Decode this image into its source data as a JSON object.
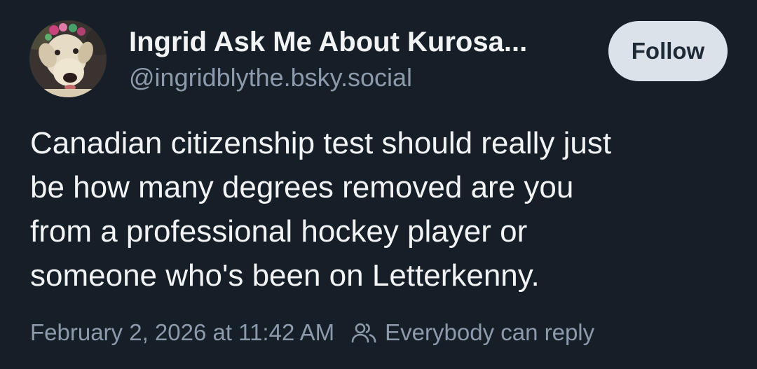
{
  "author": {
    "display_name": "Ingrid Ask Me About Kurosa...",
    "handle": "@ingridblythe.bsky.social",
    "avatar_icon": "dog-avatar-image"
  },
  "actions": {
    "follow_label": "Follow"
  },
  "post": {
    "text": "Canadian citizenship test should really just\nbe how many degrees removed are you\nfrom a professional hockey player or\nsomeone who's been on Letterkenny.",
    "timestamp": "February 2, 2026 at 11:42 AM",
    "reply_setting": "Everybody can reply",
    "reply_icon": "people-icon"
  },
  "colors": {
    "background": "#161e27",
    "primary_text": "#f1f3f5",
    "secondary_text": "#8d9aab",
    "follow_button_bg": "#dce2ea",
    "follow_button_text": "#1f2a37"
  }
}
